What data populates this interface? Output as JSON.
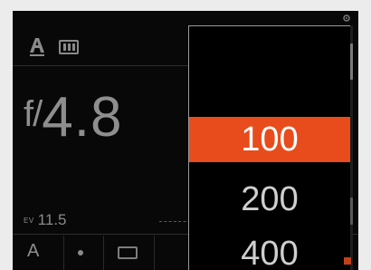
{
  "status_bar": {
    "mode_icon": "auto-mode-icon",
    "card_icon": "memory-card-icon"
  },
  "exposure": {
    "aperture_prefix": "f/",
    "aperture_value": "4.8",
    "ev_label": "EV",
    "ev_value": "11.5"
  },
  "bottom_bar": {
    "mode_letter": "A",
    "dot_icon": "metering-dot-icon",
    "frame_icon": "frame-icon"
  },
  "iso_popup": {
    "options": [
      {
        "label": "100",
        "selected": true
      },
      {
        "label": "200",
        "selected": false
      },
      {
        "label": "400",
        "selected": false
      }
    ],
    "accent_color": "#e84c1c"
  },
  "background_value": "400"
}
